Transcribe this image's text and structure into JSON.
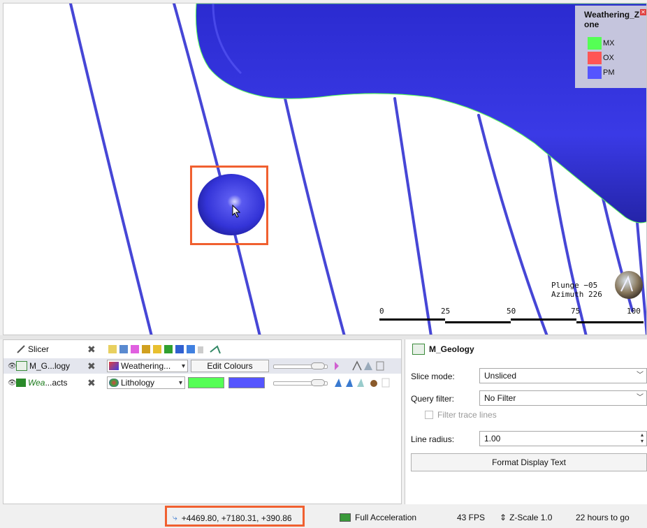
{
  "legend": {
    "title": "Weathering_Zone",
    "items": [
      {
        "label": "MX",
        "color": "#55ff55"
      },
      {
        "label": "OX",
        "color": "#ff5555"
      },
      {
        "label": "PM",
        "color": "#5555ff"
      }
    ]
  },
  "orientation": {
    "plunge": "Plunge −05",
    "azimuth": "Azimuth 226"
  },
  "scale_bar": {
    "ticks": [
      "0",
      "25",
      "50",
      "75",
      "100"
    ]
  },
  "objects": [
    {
      "name": "Slicer",
      "style": "normal"
    },
    {
      "name": "M_G...logy",
      "colour_mode": "Weathering...",
      "edit_label": "Edit Colours",
      "style": "normal"
    },
    {
      "name_part1": "Wea",
      "name_part2": "...acts",
      "colour_mode": "Lithology",
      "swatch1": "#55ff55",
      "swatch2": "#5555ff",
      "style": "italic-green"
    }
  ],
  "properties": {
    "title": "M_Geology",
    "slice_mode_label": "Slice mode:",
    "slice_mode_value": "Unsliced",
    "query_filter_label": "Query filter:",
    "query_filter_value": "No Filter",
    "filter_trace_label": "Filter trace lines",
    "line_radius_label": "Line radius:",
    "line_radius_value": "1.00",
    "format_button": "Format Display Text"
  },
  "status": {
    "coords": "+4469.80, +7180.31, +390.86",
    "acceleration": "Full Acceleration",
    "fps": "43 FPS",
    "zscale": "Z-Scale 1.0",
    "remaining": "22 hours to go"
  },
  "colors": {
    "highlight": "#f06030",
    "surface": "#3030d8",
    "line": "#4646d6"
  }
}
